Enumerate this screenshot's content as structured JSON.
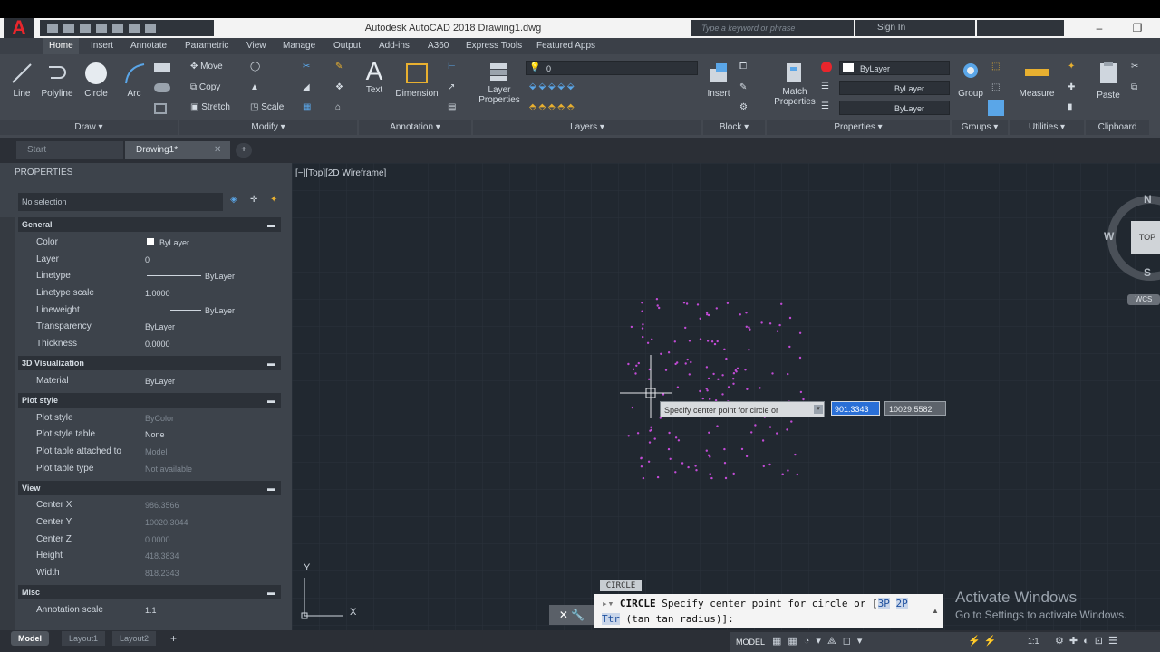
{
  "window": {
    "title": "Autodesk AutoCAD 2018    Drawing1.dwg",
    "search_placeholder": "Type a keyword or phrase",
    "sign_in": "Sign In"
  },
  "ribbon_tabs": [
    "Home",
    "Insert",
    "Annotate",
    "Parametric",
    "View",
    "Manage",
    "Output",
    "Add-ins",
    "A360",
    "Express Tools",
    "Featured Apps"
  ],
  "ribbon": {
    "draw": {
      "line": "Line",
      "polyline": "Polyline",
      "circle": "Circle",
      "arc": "Arc",
      "label": "Draw ▾"
    },
    "modify": {
      "move": "Move",
      "copy": "Copy",
      "stretch": "Stretch",
      "scale": "Scale",
      "label": "Modify ▾"
    },
    "annotation": {
      "text": "Text",
      "dimension": "Dimension",
      "label": "Annotation ▾"
    },
    "layers": {
      "layer_properties_1": "Layer",
      "layer_properties_2": "Properties",
      "current_layer": "0",
      "label": "Layers ▾"
    },
    "block": {
      "insert": "Insert",
      "label": "Block ▾"
    },
    "properties": {
      "match_1": "Match",
      "match_2": "Properties",
      "color": "ByLayer",
      "linetype": "ByLayer",
      "lineweight": "ByLayer",
      "label": "Properties ▾"
    },
    "groups": {
      "group": "Group",
      "label": "Groups ▾"
    },
    "utilities": {
      "measure": "Measure",
      "label": "Utilities ▾"
    },
    "clipboard": {
      "paste": "Paste",
      "label": "Clipboard"
    }
  },
  "file_tabs": {
    "start": "Start",
    "drawing": "Drawing1*"
  },
  "properties": {
    "title": "PROPERTIES",
    "selection": "No selection",
    "sections": {
      "general": "General",
      "viz": "3D Visualization",
      "plot": "Plot style",
      "view": "View",
      "misc": "Misc"
    },
    "general": [
      {
        "label": "Color",
        "value": "ByLayer"
      },
      {
        "label": "Layer",
        "value": "0"
      },
      {
        "label": "Linetype",
        "value": "ByLayer"
      },
      {
        "label": "Linetype scale",
        "value": "1.0000"
      },
      {
        "label": "Lineweight",
        "value": "ByLayer"
      },
      {
        "label": "Transparency",
        "value": "ByLayer"
      },
      {
        "label": "Thickness",
        "value": "0.0000"
      }
    ],
    "viz": [
      {
        "label": "Material",
        "value": "ByLayer"
      }
    ],
    "plot": [
      {
        "label": "Plot style",
        "value": "ByColor"
      },
      {
        "label": "Plot style table",
        "value": "None"
      },
      {
        "label": "Plot table attached to",
        "value": "Model"
      },
      {
        "label": "Plot table type",
        "value": "Not available"
      }
    ],
    "view": [
      {
        "label": "Center X",
        "value": "986.3566"
      },
      {
        "label": "Center Y",
        "value": "10020.3044"
      },
      {
        "label": "Center Z",
        "value": "0.0000"
      },
      {
        "label": "Height",
        "value": "418.3834"
      },
      {
        "label": "Width",
        "value": "818.2343"
      }
    ],
    "misc": [
      {
        "label": "Annotation scale",
        "value": "1:1"
      }
    ]
  },
  "viewport": {
    "label": "[−][Top][2D Wireframe]",
    "compass": {
      "n": "N",
      "s": "S",
      "w": "W",
      "top": "TOP",
      "wcs": "WCS"
    },
    "ucs": {
      "x": "X",
      "y": "Y"
    }
  },
  "dynamic_input": {
    "prompt": "Specify center point for circle or",
    "x_value": "901.3343",
    "y_value": "10029.5582"
  },
  "command_line": {
    "history": "CIRCLE",
    "cmd": "CIRCLE",
    "prompt": " Specify center point for circle or [",
    "opt_3p": "3P",
    "opt_2p": "2P",
    "line2_opt": "Ttr",
    "line2_rest": " (tan tan radius)]:"
  },
  "layout_tabs": [
    "Model",
    "Layout1",
    "Layout2"
  ],
  "status": {
    "model": "MODEL",
    "scale": "1:1"
  },
  "watermark": {
    "line1": "Activate Windows",
    "line2": "Go to Settings to activate Windows."
  }
}
